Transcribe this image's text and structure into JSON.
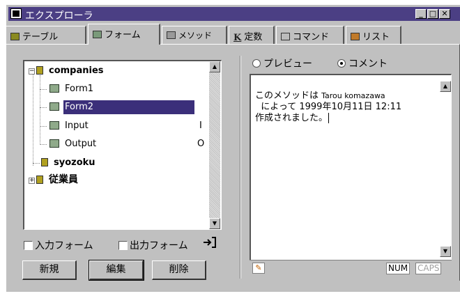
{
  "window": {
    "title": "エクスプローラ"
  },
  "tabs": [
    {
      "label": "テーブル",
      "icon": "table-icon"
    },
    {
      "label": "フォーム",
      "icon": "form-icon"
    },
    {
      "label": "メソッド",
      "icon": "method-icon"
    },
    {
      "label": "定数",
      "icon": "constant-icon"
    },
    {
      "label": "コマンド",
      "icon": "command-icon"
    },
    {
      "label": "リスト",
      "icon": "list-icon"
    }
  ],
  "tree": {
    "items": [
      {
        "label": "companies",
        "type": "table",
        "expanded": true
      },
      {
        "label": "Form1",
        "type": "form"
      },
      {
        "label": "Form2",
        "type": "form",
        "selected": true
      },
      {
        "label": "Input",
        "type": "form",
        "value": "I"
      },
      {
        "label": "Output",
        "type": "form",
        "value": "O"
      },
      {
        "label": "syozoku",
        "type": "table"
      },
      {
        "label": "従業員",
        "type": "table",
        "expanded": false
      }
    ]
  },
  "checkboxes": {
    "input_form": "入力フォーム",
    "output_form": "出力フォーム"
  },
  "buttons": {
    "new": "新規",
    "edit": "編集",
    "delete": "削除"
  },
  "preview": {
    "radio_preview": "プレビュー",
    "radio_comment": "コメント",
    "selected": "comment"
  },
  "editor": {
    "line1a": "このメソッドは ",
    "line1b": "Tarou komazawa",
    "line2": "  によって 1999年10月11日 12:11",
    "line3": "作成されました。"
  },
  "status": {
    "num": "NUM",
    "caps": "CAPS"
  }
}
